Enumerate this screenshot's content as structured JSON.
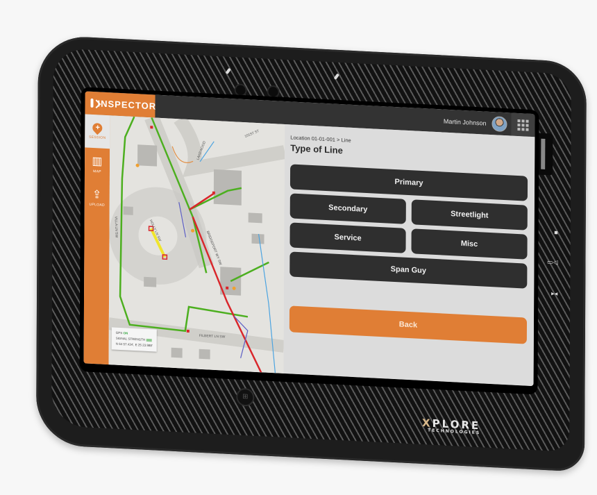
{
  "app": {
    "name": "INSPECTOR",
    "accent_color": "#e07e35",
    "topbar_color": "#333333"
  },
  "header": {
    "user_name": "Martin Johnson",
    "apps_icon": "grid-icon",
    "avatar_icon": "user-avatar"
  },
  "sidebar": {
    "items": [
      {
        "label": "SESSION",
        "icon": "add-location-pin-icon",
        "active": true
      },
      {
        "label": "MAP",
        "icon": "map-icon",
        "active": false
      },
      {
        "label": "UPLOAD",
        "icon": "upload-icon",
        "active": false
      }
    ]
  },
  "map": {
    "streets": [
      "LAKEWOOD",
      "101ST ST",
      "BRIDGEPORT WY SW",
      "HOLLY LN SW",
      "VILLA LN SW",
      "FILBERT LN SW"
    ],
    "gps_panel": {
      "gps_label": "GPS",
      "gps_status": "ON",
      "signal_label": "SIGNAL STRENGTH",
      "coordinates": "N 64 57.434', E 25 23.988'"
    }
  },
  "panel": {
    "breadcrumb": "Location 01-01-001 > Line",
    "title": "Type of Line",
    "options": [
      "Primary",
      "Secondary",
      "Streetlight",
      "Service",
      "Misc",
      "Span Guy"
    ],
    "back_label": "Back"
  },
  "device": {
    "brand": "XPLORE",
    "brand_x": "X",
    "brand_rest": "PLORE",
    "brand_sub": "TECHNOLOGIES"
  }
}
